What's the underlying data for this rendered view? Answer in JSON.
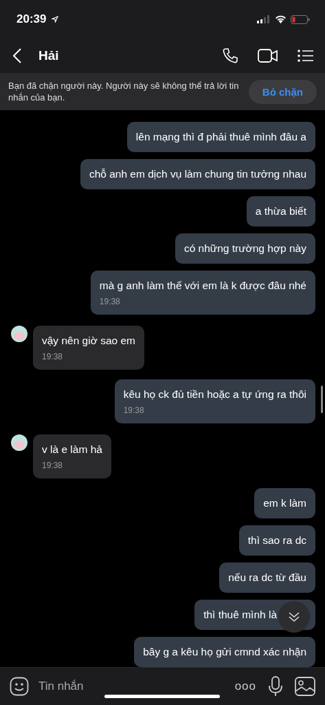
{
  "status_bar": {
    "time": "20:39"
  },
  "header": {
    "title": "Hải"
  },
  "block_banner": {
    "text": "Bạn đã chặn người này. Người này sẽ không thể trả lời tin nhắn của bạn.",
    "button": "Bỏ chặn"
  },
  "messages": [
    {
      "kind": "out",
      "text": "lên mạng thì đ phải thuê mình đâu a"
    },
    {
      "kind": "out",
      "text": "chỗ anh em dịch vụ làm chung tin tưởng nhau"
    },
    {
      "kind": "out",
      "text": "a thừa biết"
    },
    {
      "kind": "out",
      "text": "có những trường hợp này"
    },
    {
      "kind": "out",
      "text": "mà g anh làm thế với em là k được đâu nhé",
      "time": "19:38"
    },
    {
      "kind": "in",
      "text": "vậy nên giờ sao em",
      "time": "19:38"
    },
    {
      "kind": "out",
      "text": "kêu họ ck đủ tiền hoặc a tự ứng ra thôi",
      "time": "19:38"
    },
    {
      "kind": "in",
      "text": "v là e làm hả",
      "time": "19:38"
    },
    {
      "kind": "out",
      "text": "em k làm"
    },
    {
      "kind": "out",
      "text": "thì sao ra dc"
    },
    {
      "kind": "out",
      "text": "nếu ra dc từ đầu"
    },
    {
      "kind": "out",
      "text": "thì thuê mình là",
      "obscured": true
    },
    {
      "kind": "out",
      "text": "bây g a kêu họ gửi cmnd xác nhận"
    }
  ],
  "composer": {
    "placeholder": "Tin nhắn",
    "more": "ooo"
  }
}
